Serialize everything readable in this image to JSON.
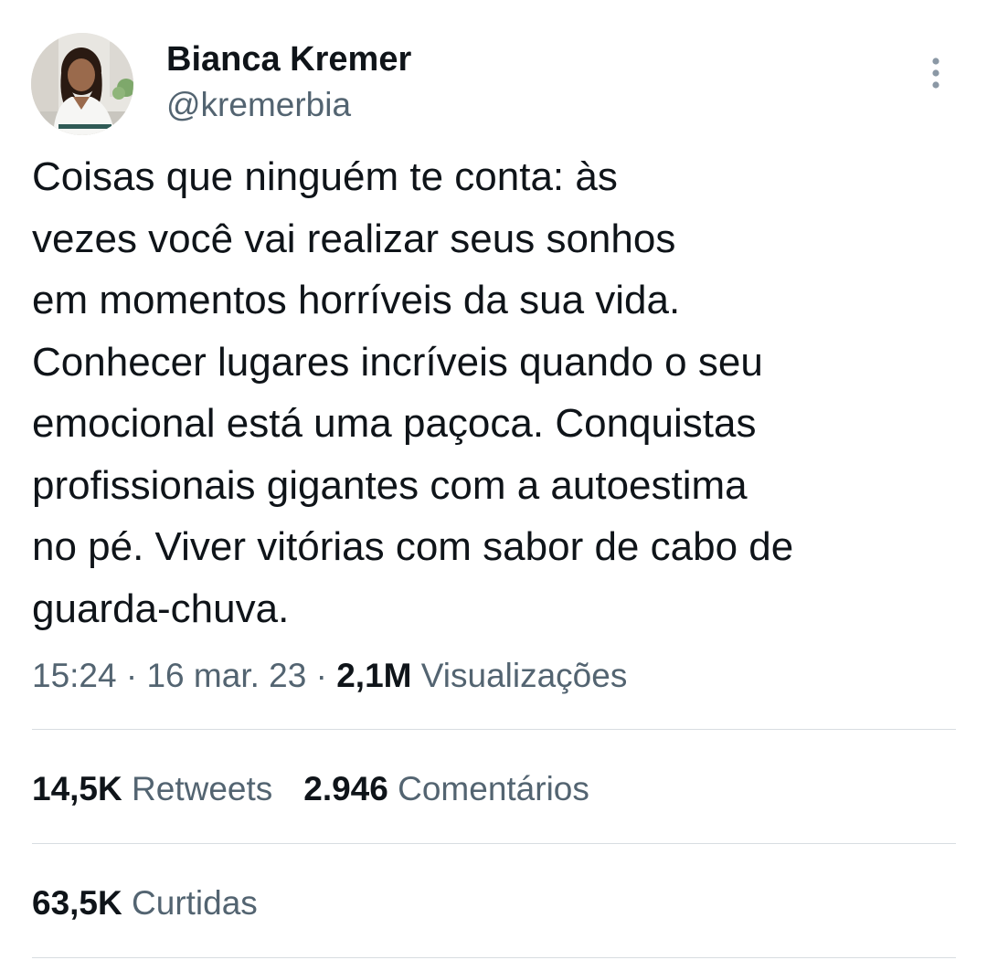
{
  "user": {
    "display_name": "Bianca Kremer",
    "handle": "@kremerbia"
  },
  "more_icon": "more-vertical-icon",
  "tweet": {
    "lines": [
      "Coisas que ninguém te conta: às",
      "vezes você vai realizar seus sonhos",
      "em momentos horríveis da sua vida.",
      "Conhecer lugares incríveis quando o seu",
      "emocional está uma paçoca. Conquistas",
      "profissionais gigantes com a autoestima",
      "no pé. Viver vitórias com sabor de cabo de",
      "guarda-chuva."
    ]
  },
  "meta": {
    "time": "15:24",
    "separator": " · ",
    "date": "16 mar. 23",
    "views_count": "2,1M",
    "views_label": "Visualizações"
  },
  "stats": {
    "retweets_count": "14,5K",
    "retweets_label": "Retweets",
    "comments_count": "2.946",
    "comments_label": "Comentários",
    "likes_count": "63,5K",
    "likes_label": "Curtidas"
  },
  "colors": {
    "text_primary": "#0f1419",
    "text_secondary": "#536471",
    "divider": "#d8dde1"
  }
}
